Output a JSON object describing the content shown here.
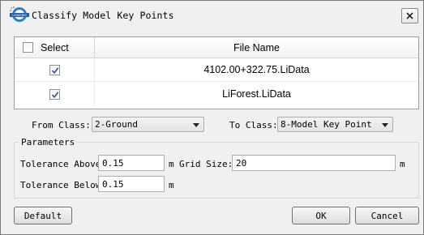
{
  "window": {
    "title": "Classify Model Key Points",
    "icon": "lidar360-app-icon"
  },
  "table": {
    "header_select": "Select",
    "header_file_name": "File Name",
    "header_checkbox_checked": false,
    "rows": [
      {
        "checked": true,
        "file_name": "4102.00+322.75.LiData"
      },
      {
        "checked": true,
        "file_name": "LiForest.LiData"
      }
    ]
  },
  "from_class": {
    "label": "From Class:",
    "value": "2-Ground"
  },
  "to_class": {
    "label": "To Class:",
    "value": "8-Model Key Point"
  },
  "parameters": {
    "title": "Parameters",
    "tolerance_above_label": "Tolerance Above",
    "tolerance_above_value": "0.15",
    "tolerance_above_unit": "m",
    "grid_size_label": "Grid Size:",
    "grid_size_value": "20",
    "grid_size_unit": "m",
    "tolerance_below_label": "Tolerance Below",
    "tolerance_below_value": "0.15",
    "tolerance_below_unit": "m"
  },
  "buttons": {
    "default": "Default",
    "ok": "OK",
    "cancel": "Cancel"
  }
}
